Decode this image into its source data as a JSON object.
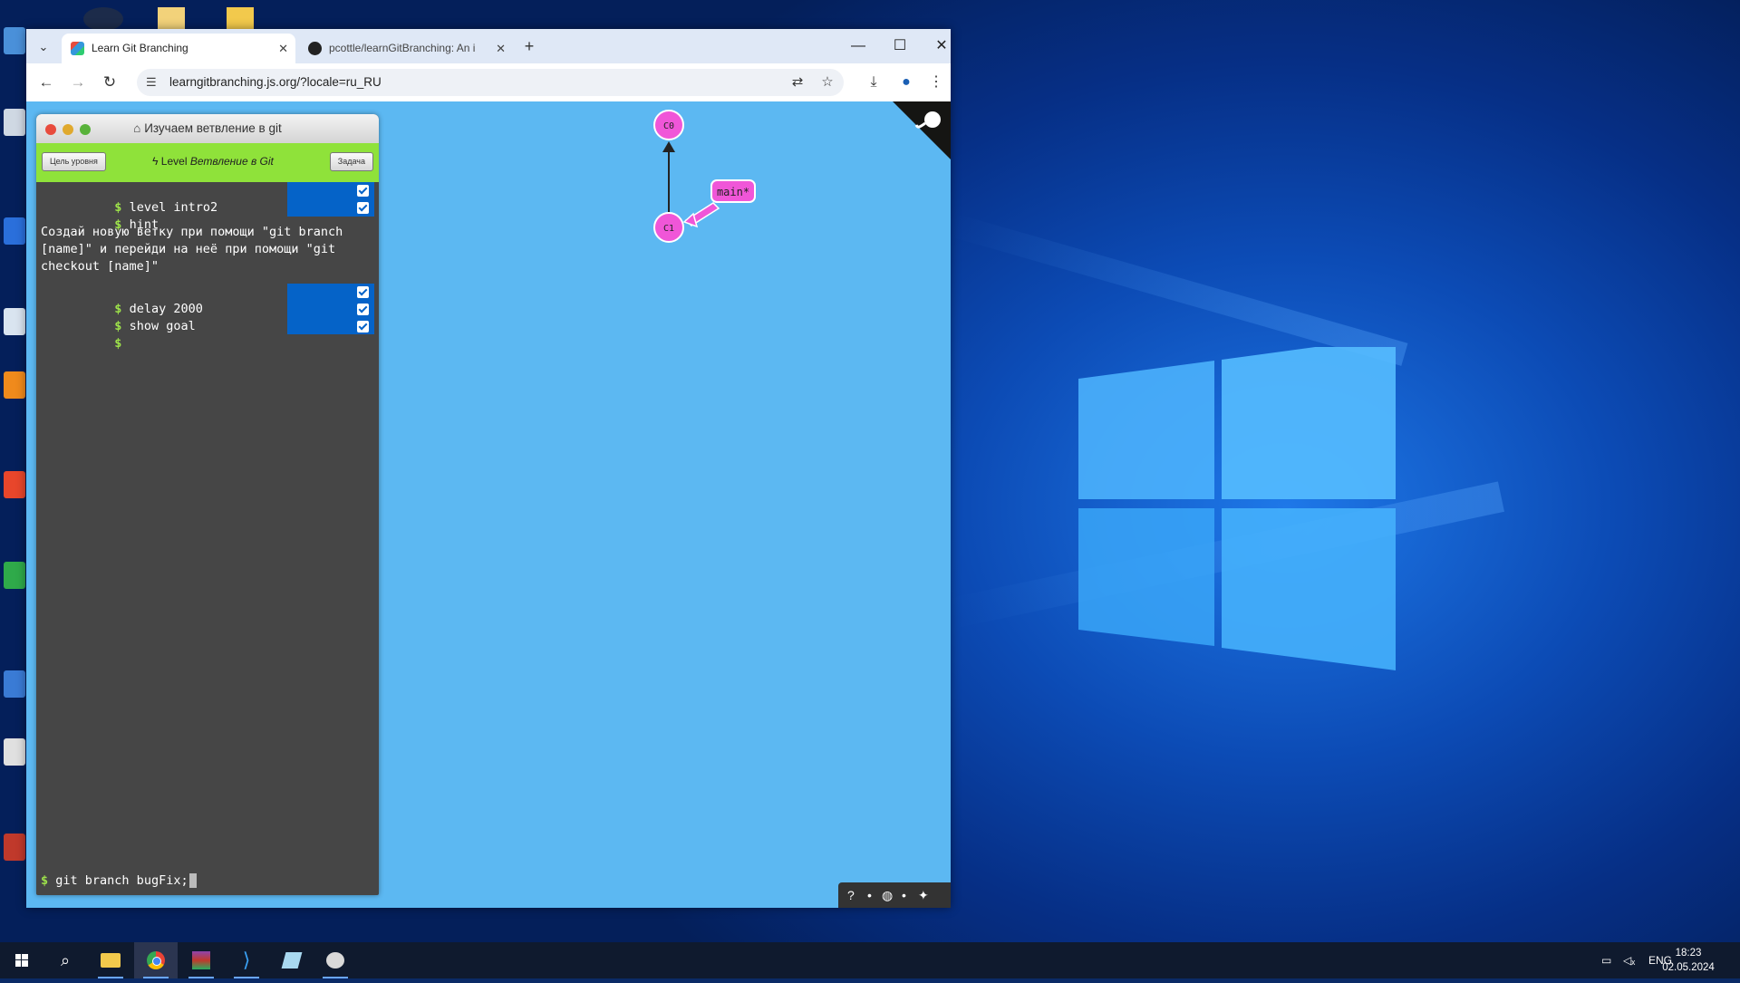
{
  "browser": {
    "tabs": [
      {
        "title": "Learn Git Branching",
        "active": true
      },
      {
        "title": "pcottle/learnGitBranching: An i",
        "active": false
      }
    ],
    "url": "learngitbranching.js.org/?locale=ru_RU"
  },
  "app": {
    "window_title": "Изучаем ветвление в git",
    "level_goal_button": "Цель уровня",
    "level_prefix": "Level",
    "level_name": "Ветвление в Git",
    "task_button": "Задача",
    "prompt_symbol": "$",
    "history": [
      {
        "command": "level intro2",
        "checked": true
      },
      {
        "command": "hint",
        "checked": true
      }
    ],
    "hint_text": "Создай новую ветку при помощи \"git branch [name]\" и перейди на неё при помощи \"git checkout [name]\"",
    "history2": [
      {
        "command": "delay 2000",
        "checked": true
      },
      {
        "command": "show goal",
        "checked": true
      },
      {
        "command": "",
        "checked": true
      }
    ],
    "command_input": "git branch bugFix;",
    "graph": {
      "commits": [
        "C0",
        "C1"
      ],
      "branch_label": "main*",
      "commit_color": "#f056d8"
    }
  },
  "taskbar": {
    "language": "ENG",
    "time": "18:23",
    "date": "02.05.2024"
  }
}
